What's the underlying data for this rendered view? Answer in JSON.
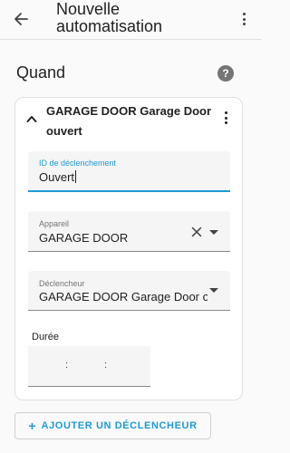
{
  "header": {
    "title": "Nouvelle automatisation",
    "back_icon": "arrow-left-icon",
    "menu_icon": "more-vertical-icon"
  },
  "section": {
    "title": "Quand",
    "help_icon": "help-circle-icon",
    "help_glyph": "?"
  },
  "trigger_card": {
    "title": "GARAGE DOOR Garage Door ouvert",
    "collapse_icon": "chevron-up-icon",
    "menu_icon": "more-vertical-icon",
    "trigger_id": {
      "label": "ID de déclenchement",
      "value": "Ouvert"
    },
    "device": {
      "label": "Appareil",
      "value": "GARAGE DOOR",
      "clear_icon": "close-icon",
      "dropdown_icon": "chevron-down-icon"
    },
    "trigger": {
      "label": "Déclencheur",
      "value": "GARAGE DOOR Garage Door ouvert",
      "dropdown_icon": "chevron-down-icon"
    },
    "duration": {
      "label": "Durée",
      "separator": ":"
    }
  },
  "add_trigger_button": {
    "label": "AJOUTER UN DÉCLENCHEUR",
    "icon": "plus-icon",
    "glyph": "+"
  },
  "colors": {
    "accent": "#1f9ad6",
    "text": "#212121",
    "muted": "#757575",
    "field_bg": "#f5f5f5",
    "card_border": "#e0e0e0"
  }
}
